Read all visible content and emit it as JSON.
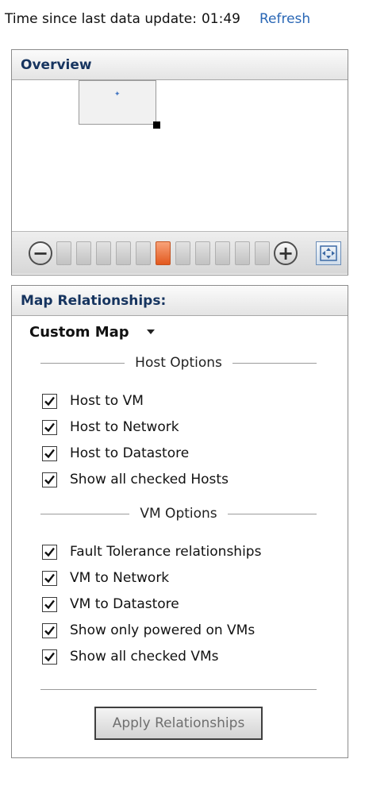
{
  "status": {
    "label": "Time since last data update:",
    "time": "01:49",
    "refresh_label": "Refresh"
  },
  "overview": {
    "title": "Overview",
    "zoom": {
      "steps": 11,
      "active_step": 6,
      "zoom_out_symbol": "−",
      "zoom_in_symbol": "+"
    },
    "icons": {
      "zoom_out": "zoom-out-icon",
      "zoom_in": "zoom-in-icon",
      "fit": "fit-to-window-icon"
    }
  },
  "map": {
    "title": "Map Relationships:",
    "selected_map": "Custom Map",
    "host_options": {
      "heading": "Host Options",
      "items": [
        {
          "label": "Host to VM",
          "checked": true
        },
        {
          "label": "Host to Network",
          "checked": true
        },
        {
          "label": "Host to Datastore",
          "checked": true
        },
        {
          "label": "Show all checked Hosts",
          "checked": true
        }
      ]
    },
    "vm_options": {
      "heading": "VM Options",
      "items": [
        {
          "label": "Fault Tolerance relationships",
          "checked": true
        },
        {
          "label": "VM to Network",
          "checked": true
        },
        {
          "label": "VM to Datastore",
          "checked": true
        },
        {
          "label": "Show only powered on VMs",
          "checked": true
        },
        {
          "label": "Show all checked VMs",
          "checked": true
        }
      ]
    },
    "apply_label": "Apply Relationships"
  },
  "colors": {
    "header_text": "#16345f",
    "link": "#2a67b5",
    "active_zoom": "#e2581e"
  }
}
